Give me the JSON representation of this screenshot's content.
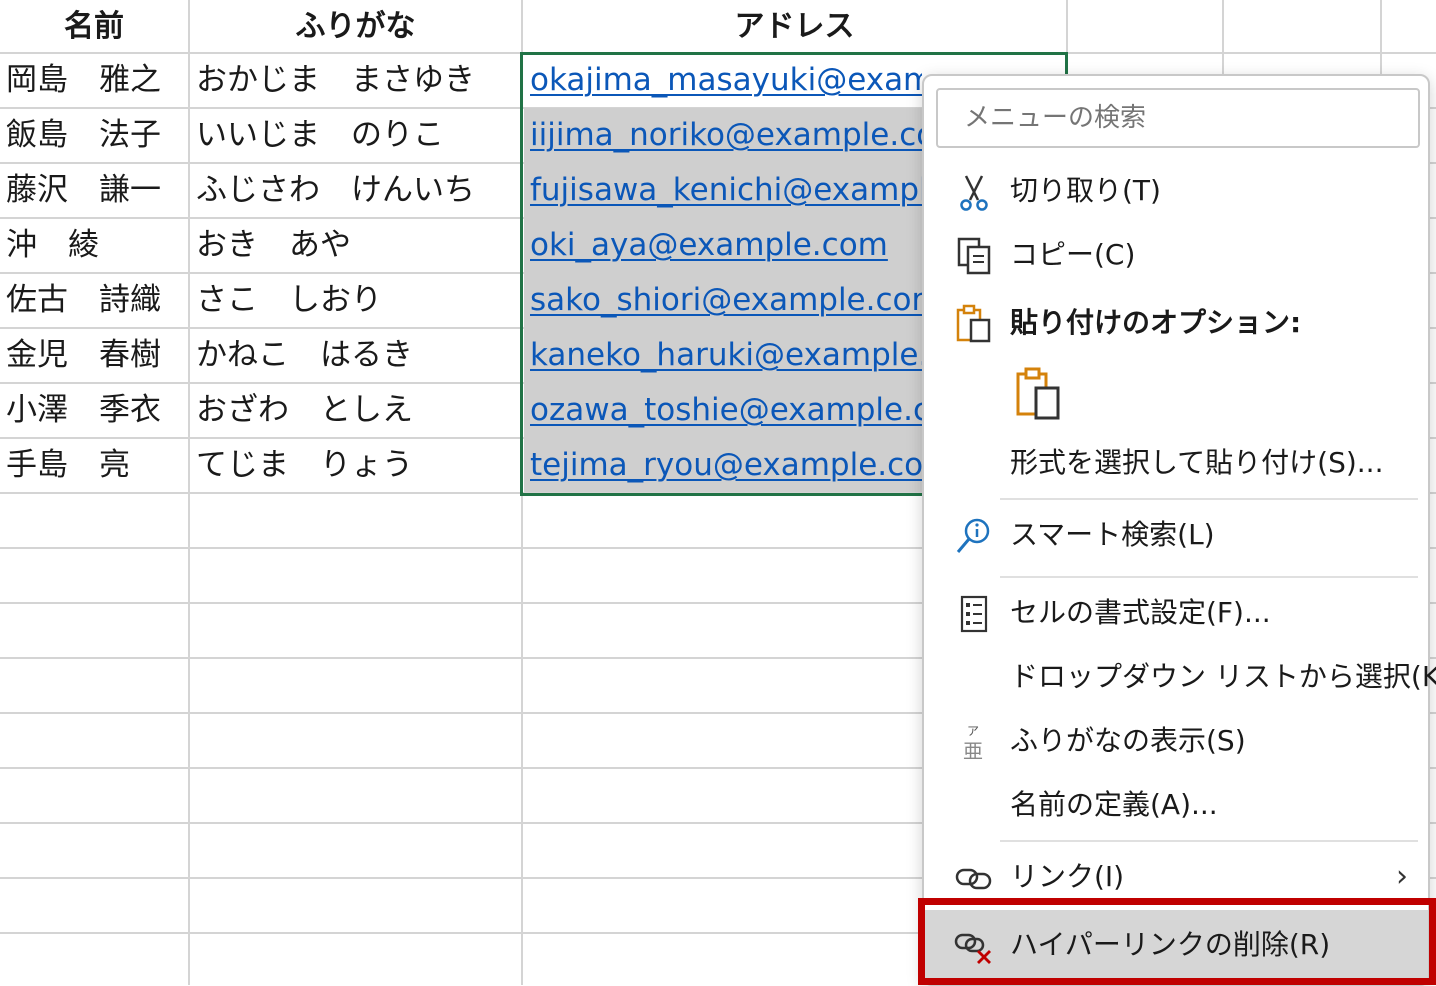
{
  "headers": {
    "name": "名前",
    "kana": "ふりがな",
    "address": "アドレス"
  },
  "rows": [
    {
      "name": "岡島　雅之",
      "kana": "おかじま　まさゆき",
      "email": "okajima_masayuki@example.com"
    },
    {
      "name": "飯島　法子",
      "kana": "いいじま　のりこ",
      "email": "iijima_noriko@example.com"
    },
    {
      "name": "藤沢　謙一",
      "kana": "ふじさわ　けんいち",
      "email": "fujisawa_kenichi@example.com"
    },
    {
      "name": "沖　綾",
      "kana": "おき　あや",
      "email": "oki_aya@example.com"
    },
    {
      "name": "佐古　詩織",
      "kana": "さこ　しおり",
      "email": "sako_shiori@example.com"
    },
    {
      "name": "金児　春樹",
      "kana": "かねこ　はるき",
      "email": "kaneko_haruki@example.com"
    },
    {
      "name": "小澤　季衣",
      "kana": "おざわ　としえ",
      "email": "ozawa_toshie@example.com"
    },
    {
      "name": "手島　亮",
      "kana": "てじま　りょう",
      "email": "tejima_ryou@example.com"
    }
  ],
  "menu": {
    "search_placeholder": "メニューの検索",
    "cut": "切り取り(T)",
    "copy": "コピー(C)",
    "paste_options": "貼り付けのオプション:",
    "paste_special": "形式を選択して貼り付け(S)...",
    "smart_lookup": "スマート検索(L)",
    "format_cells": "セルの書式設定(F)...",
    "dropdown": "ドロップダウン リストから選択(K)...",
    "show_furigana": "ふりがなの表示(S)",
    "define_name": "名前の定義(A)...",
    "link": "リンク(I)",
    "remove_hyperlink": "ハイパーリンクの削除(R)"
  },
  "colors": {
    "selection_border": "#217346",
    "hyperlink": "#0b57b8",
    "highlight_box": "#c00000",
    "icon_orange": "#d4820b",
    "icon_blue": "#1e73be"
  }
}
